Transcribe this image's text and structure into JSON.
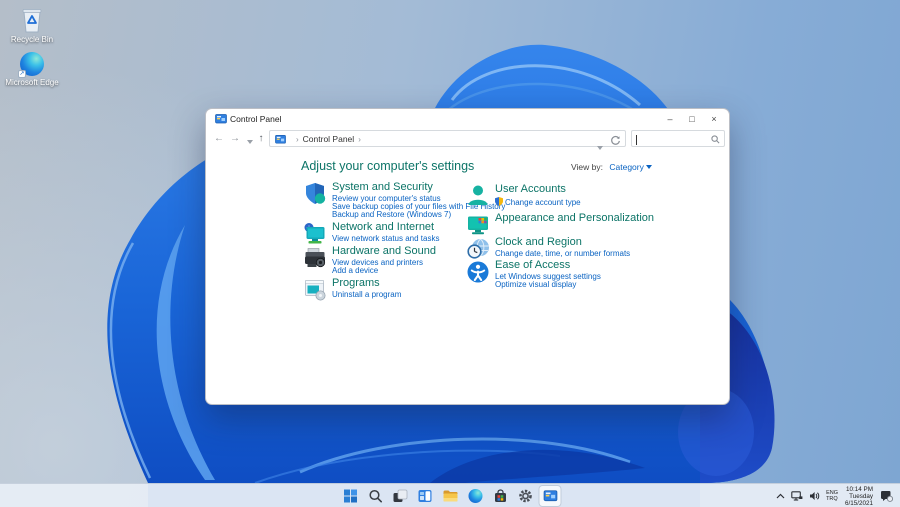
{
  "desktop": {
    "icons": [
      {
        "label": "Recycle Bin"
      },
      {
        "label": "Microsoft Edge"
      }
    ]
  },
  "window": {
    "title": "Control Panel",
    "controls": {
      "minimize": "–",
      "maximize": "□",
      "close": "×"
    },
    "nav": {
      "back": "←",
      "forward": "→",
      "up": "↑",
      "crumb_sep1": "›",
      "breadcrumb": "Control Panel",
      "crumb_sep2": "›"
    },
    "search": {
      "placeholder": "",
      "value": ""
    },
    "heading": "Adjust your computer's settings",
    "view_by": {
      "label": "View by:",
      "value": "Category"
    },
    "categories_left": [
      {
        "name": "System and Security",
        "links": [
          "Review your computer's status",
          "Save backup copies of your files with File History",
          "Backup and Restore (Windows 7)"
        ]
      },
      {
        "name": "Network and Internet",
        "links": [
          "View network status and tasks"
        ]
      },
      {
        "name": "Hardware and Sound",
        "links": [
          "View devices and printers",
          "Add a device"
        ]
      },
      {
        "name": "Programs",
        "links": [
          "Uninstall a program"
        ]
      }
    ],
    "categories_right": [
      {
        "name": "User Accounts",
        "links": [
          "Change account type"
        ]
      },
      {
        "name": "Appearance and Personalization",
        "links": []
      },
      {
        "name": "Clock and Region",
        "links": [
          "Change date, time, or number formats"
        ]
      },
      {
        "name": "Ease of Access",
        "links": [
          "Let Windows suggest settings",
          "Optimize visual display"
        ]
      }
    ]
  },
  "taskbar": {
    "buttons": [
      "start",
      "search",
      "task-view",
      "widgets",
      "file-explorer",
      "edge",
      "store",
      "settings",
      "control-panel"
    ],
    "active_button": "control-panel",
    "tray": {
      "language_line1": "ENG",
      "language_line2": "TRQ",
      "time": "10:14 PM",
      "day": "Tuesday",
      "date": "6/15/2021"
    }
  },
  "colors": {
    "category_title": "#0c7467",
    "link": "#0a63c2",
    "taskbar_bg": "#e7edf6",
    "bloom_blue": "#1a66d8",
    "bloom_dark": "#16309c"
  }
}
